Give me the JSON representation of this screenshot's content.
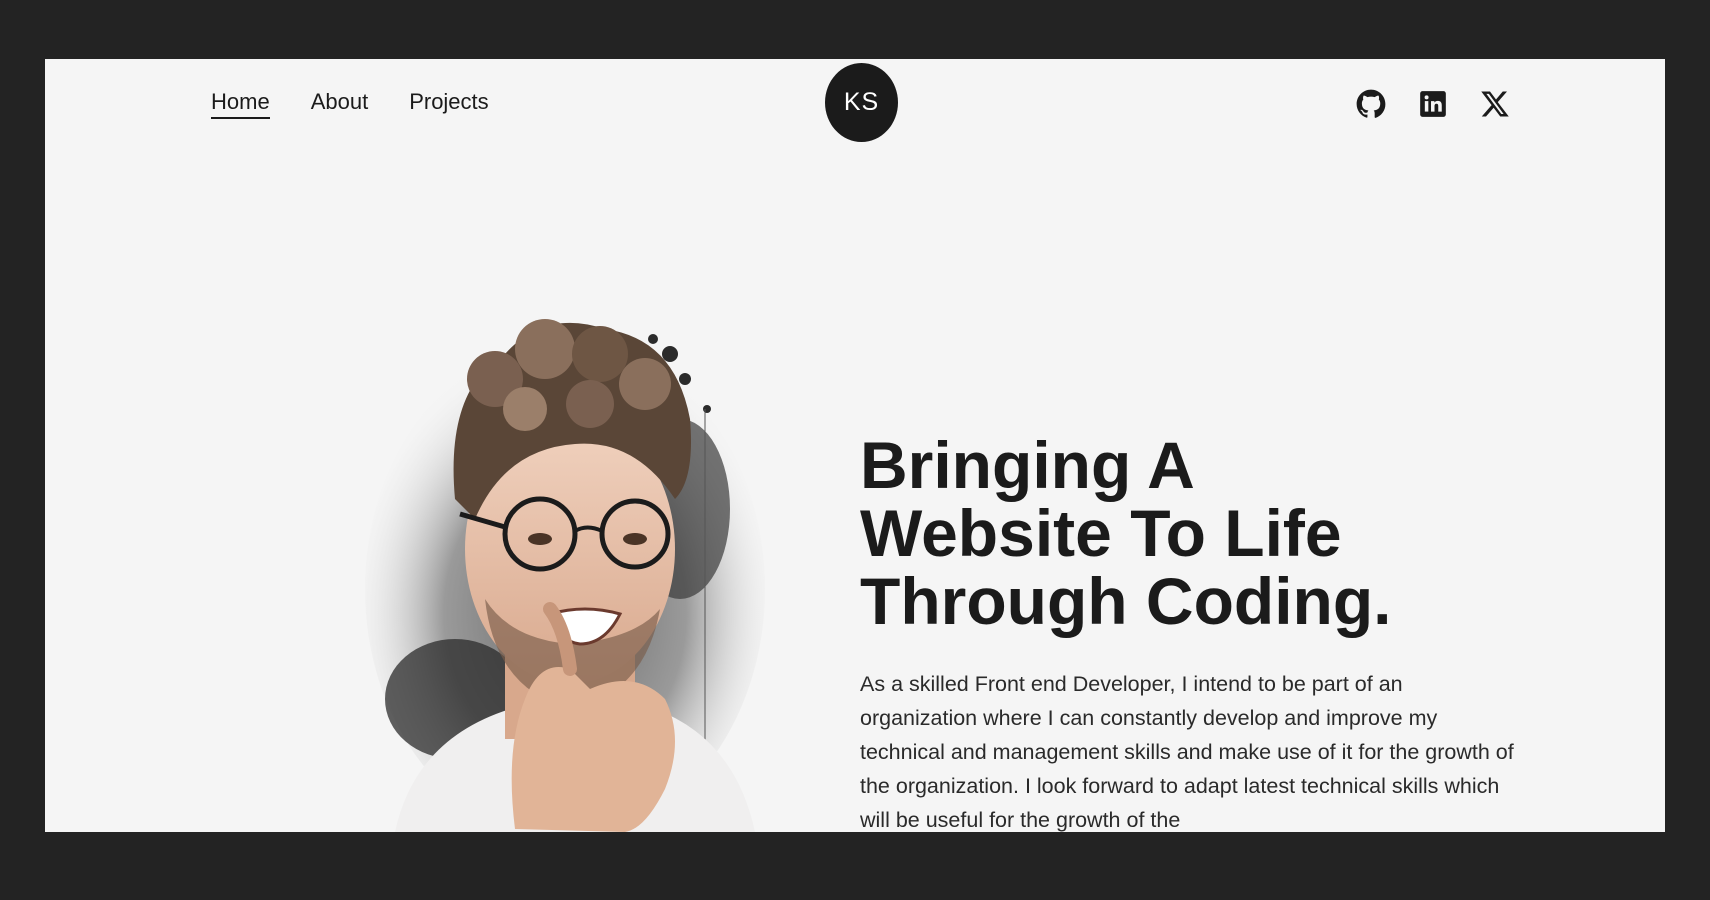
{
  "nav": {
    "links": [
      {
        "label": "Home",
        "active": true
      },
      {
        "label": "About",
        "active": false
      },
      {
        "label": "Projects",
        "active": false
      }
    ]
  },
  "logo": {
    "text": "KS"
  },
  "social": {
    "icons": [
      "github-icon",
      "linkedin-icon",
      "x-icon"
    ]
  },
  "hero": {
    "headline_lines": [
      "Bringing A",
      "Website To Life",
      "Through Coding."
    ],
    "bio": "As a skilled Front end Developer, I intend to be part of an organization where I can constantly develop and improve my technical and management skills and make use of it for the growth of the organization. I look forward to adapt latest technical skills which will be useful for the growth of the"
  },
  "colors": {
    "background": "#f5f5f5",
    "frame": "#232323",
    "text": "#1b1b1b"
  }
}
